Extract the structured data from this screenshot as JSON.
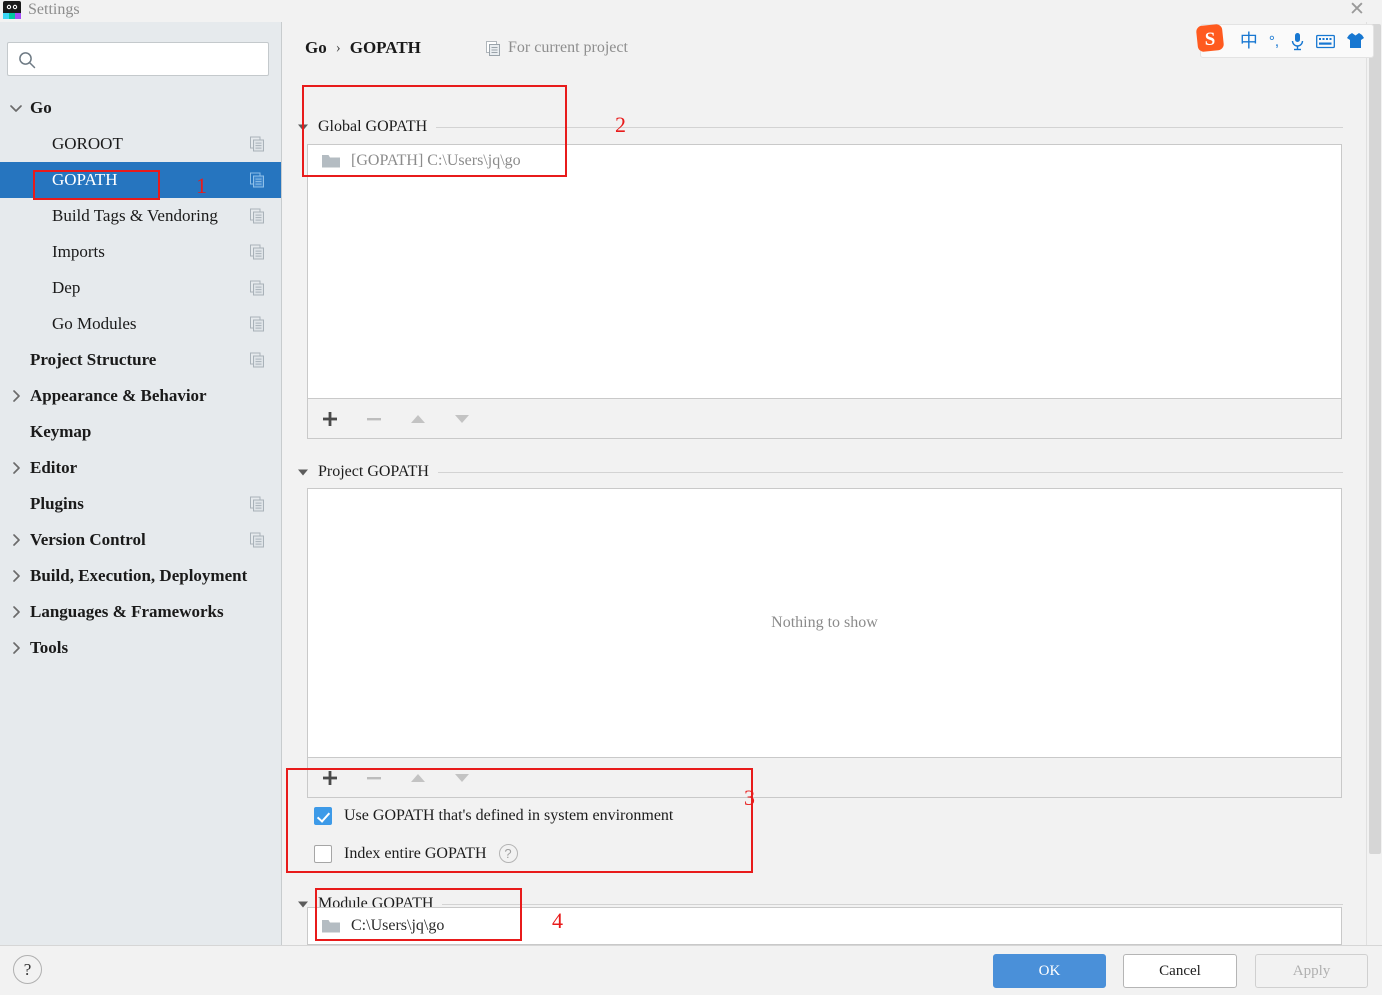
{
  "window": {
    "title": "Settings",
    "app_icon": "goland-icon",
    "close_label": "✕"
  },
  "sidebar": {
    "search": {
      "value": "",
      "placeholder": "",
      "icon": "search-icon"
    },
    "items": [
      {
        "label": "Go",
        "twisty": "chevron-down",
        "indent": 0,
        "bold": true,
        "copy": false,
        "selected": false
      },
      {
        "label": "GOROOT",
        "twisty": "none",
        "indent": 1,
        "bold": false,
        "copy": true,
        "selected": false
      },
      {
        "label": "GOPATH",
        "twisty": "none",
        "indent": 1,
        "bold": false,
        "copy": true,
        "selected": true
      },
      {
        "label": "Build Tags & Vendoring",
        "twisty": "none",
        "indent": 1,
        "bold": false,
        "copy": true,
        "selected": false
      },
      {
        "label": "Imports",
        "twisty": "none",
        "indent": 1,
        "bold": false,
        "copy": true,
        "selected": false
      },
      {
        "label": "Dep",
        "twisty": "none",
        "indent": 1,
        "bold": false,
        "copy": true,
        "selected": false
      },
      {
        "label": "Go Modules",
        "twisty": "none",
        "indent": 1,
        "bold": false,
        "copy": true,
        "selected": false
      },
      {
        "label": "Project Structure",
        "twisty": "none",
        "indent": 0,
        "bold": true,
        "copy": true,
        "selected": false
      },
      {
        "label": "Appearance & Behavior",
        "twisty": "chevron-right",
        "indent": 0,
        "bold": true,
        "copy": false,
        "selected": false
      },
      {
        "label": "Keymap",
        "twisty": "none",
        "indent": 0,
        "bold": true,
        "copy": false,
        "selected": false
      },
      {
        "label": "Editor",
        "twisty": "chevron-right",
        "indent": 0,
        "bold": true,
        "copy": false,
        "selected": false
      },
      {
        "label": "Plugins",
        "twisty": "none",
        "indent": 0,
        "bold": true,
        "copy": true,
        "selected": false
      },
      {
        "label": "Version Control",
        "twisty": "chevron-right",
        "indent": 0,
        "bold": true,
        "copy": true,
        "selected": false
      },
      {
        "label": "Build, Execution, Deployment",
        "twisty": "chevron-right",
        "indent": 0,
        "bold": true,
        "copy": false,
        "selected": false
      },
      {
        "label": "Languages & Frameworks",
        "twisty": "chevron-right",
        "indent": 0,
        "bold": true,
        "copy": false,
        "selected": false
      },
      {
        "label": "Tools",
        "twisty": "chevron-right",
        "indent": 0,
        "bold": true,
        "copy": false,
        "selected": false
      }
    ]
  },
  "header": {
    "breadcrumb_root": "Go",
    "breadcrumb_sep": "›",
    "breadcrumb_leaf": "GOPATH",
    "for_current_project": "For current project",
    "for_current_icon": "copy-settings-icon"
  },
  "global_gopath": {
    "title": "Global GOPATH",
    "twisty": "triangle-down",
    "entries": [
      {
        "icon": "folder-icon",
        "label": "[GOPATH] C:\\Users\\jq\\go"
      }
    ],
    "toolbar": [
      {
        "name": "add-button",
        "glyph": "+",
        "enabled": true
      },
      {
        "name": "remove-button",
        "glyph": "−",
        "enabled": false
      },
      {
        "name": "move-up-button",
        "glyph": "▲",
        "enabled": false
      },
      {
        "name": "move-down-button",
        "glyph": "▼",
        "enabled": false
      }
    ]
  },
  "project_gopath": {
    "title": "Project GOPATH",
    "twisty": "triangle-down",
    "empty_message": "Nothing to show",
    "entries": [],
    "toolbar": [
      {
        "name": "add-button",
        "glyph": "+",
        "enabled": true
      },
      {
        "name": "remove-button",
        "glyph": "−",
        "enabled": false
      },
      {
        "name": "move-up-button",
        "glyph": "▲",
        "enabled": false
      },
      {
        "name": "move-down-button",
        "glyph": "▼",
        "enabled": false
      }
    ],
    "options": [
      {
        "label": "Use GOPATH that's defined in system environment",
        "checked": true,
        "help": false
      },
      {
        "label": "Index entire GOPATH",
        "checked": false,
        "help": true,
        "help_glyph": "?"
      }
    ]
  },
  "module_gopath": {
    "title": "Module GOPATH",
    "twisty": "triangle-down",
    "entries": [
      {
        "icon": "folder-icon",
        "label": "C:\\Users\\jq\\go"
      }
    ]
  },
  "footer": {
    "help_glyph": "?",
    "ok": "OK",
    "cancel": "Cancel",
    "apply": "Apply"
  },
  "ime_toolbar": {
    "logo": "sogou-logo-icon",
    "items": [
      {
        "name": "chinese-mode-icon",
        "glyph": "中"
      },
      {
        "name": "punctuation-mode-icon",
        "glyph": "°,"
      },
      {
        "name": "voice-input-icon",
        "glyph": "🎙"
      },
      {
        "name": "soft-keyboard-icon",
        "glyph": "⌨"
      },
      {
        "name": "skin-icon",
        "glyph": "👕"
      }
    ]
  },
  "annotations": [
    {
      "number": "1",
      "target": "sidebar-gopath"
    },
    {
      "number": "2",
      "target": "global-gopath-section"
    },
    {
      "number": "3",
      "target": "gopath-options"
    },
    {
      "number": "4",
      "target": "module-gopath-entry"
    }
  ],
  "colors": {
    "selection_blue": "#2675bf",
    "annotation_red": "#e81b1b",
    "primary_button": "#4a90d9",
    "checkbox_checked": "#3d9ae8",
    "sidebar_bg": "#e6eaed"
  }
}
